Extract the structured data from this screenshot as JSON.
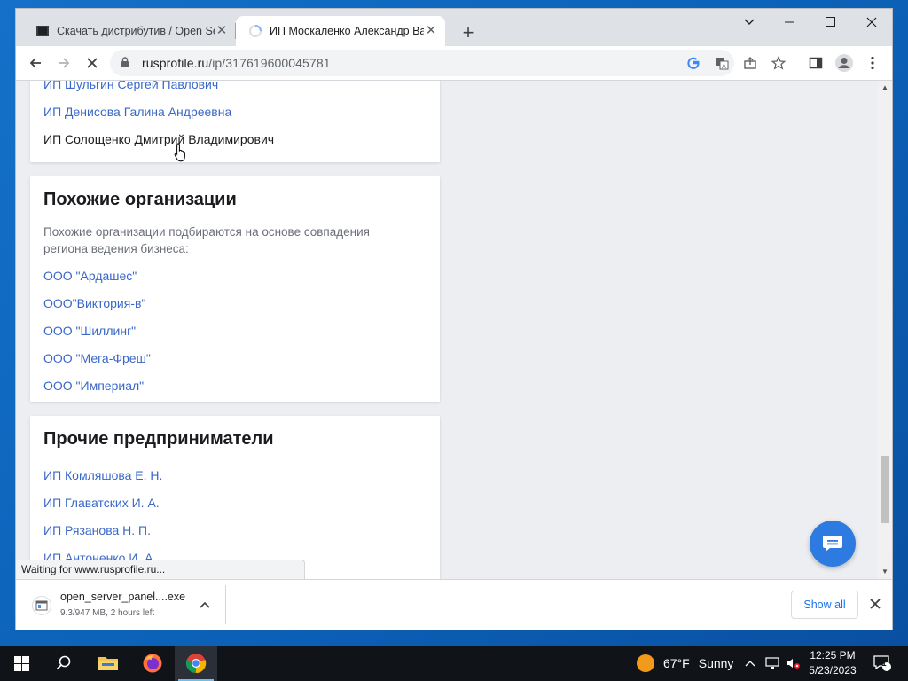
{
  "browser": {
    "tabs": [
      {
        "title": "Скачать дистрибутив / Open Serv",
        "active": false
      },
      {
        "title": "ИП Москаленко Александр Вал",
        "active": true
      }
    ],
    "new_tab_label": "+",
    "address": {
      "host": "rusprofile.ru",
      "path": "/ip/317619600045781"
    },
    "status_text": "Waiting for www.rusprofile.ru..."
  },
  "page": {
    "top_list": [
      {
        "label": "ИП Шульгин Сергей Павлович",
        "hover": false
      },
      {
        "label": "ИП Денисова Галина Андреевна",
        "hover": false
      },
      {
        "label": "ИП Солощенко Дмитрий Владимирович",
        "hover": true
      }
    ],
    "similar": {
      "heading": "Похожие организации",
      "description": "Похожие организации подбираются на основе совпадения региона ведения бизнеса:",
      "items": [
        "ООО \"Ардашес\"",
        "ООО\"Виктория-в\"",
        "ООО \"Шиллинг\"",
        "ООО \"Мега-Фреш\"",
        "ООО \"Империал\""
      ]
    },
    "other": {
      "heading": "Прочие предприниматели",
      "items": [
        "ИП Комляшова Е. Н.",
        "ИП Главатских И. А.",
        "ИП Рязанова Н. П.",
        "ИП Антоненко И. А."
      ]
    }
  },
  "downloads": {
    "file_name": "open_server_panel....exe",
    "progress": "9.3/947 MB, 2 hours left",
    "show_all_label": "Show all"
  },
  "taskbar": {
    "weather_temp": "67°F",
    "weather_text": "Sunny",
    "time": "12:25 PM",
    "date": "5/23/2023",
    "notification_count": "1"
  },
  "colors": {
    "link": "#3a68c8",
    "accent": "#2d7be0",
    "chrome_tab_bg": "#dee1e6"
  }
}
